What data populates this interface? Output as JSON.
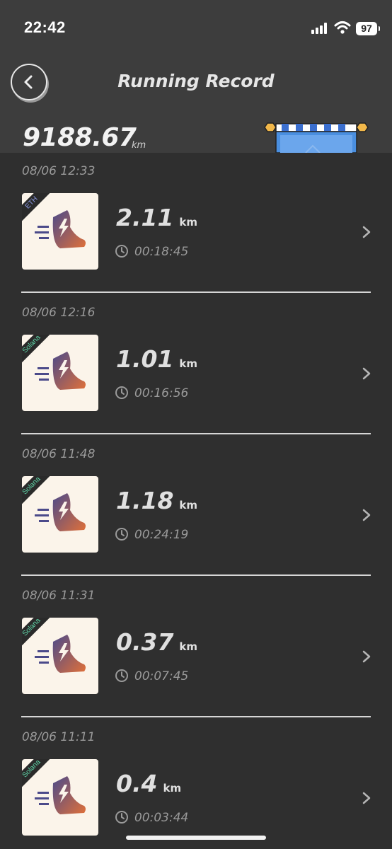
{
  "status_bar": {
    "time": "22:42",
    "battery": "97"
  },
  "header": {
    "title": "Running Record"
  },
  "summary": {
    "total_distance": "9188.67",
    "unit": "km"
  },
  "records": [
    {
      "date": "08/06 12:33",
      "chain": "ETH",
      "distance": "2.11",
      "unit": "km",
      "duration": "00:18:45"
    },
    {
      "date": "08/06 12:16",
      "chain": "Solana",
      "distance": "1.01",
      "unit": "km",
      "duration": "00:16:56"
    },
    {
      "date": "08/06 11:48",
      "chain": "Solana",
      "distance": "1.18",
      "unit": "km",
      "duration": "00:24:19"
    },
    {
      "date": "08/06 11:31",
      "chain": "Solana",
      "distance": "0.37",
      "unit": "km",
      "duration": "00:07:45"
    },
    {
      "date": "08/06 11:11",
      "chain": "Solana",
      "distance": "0.4",
      "unit": "km",
      "duration": "00:03:44"
    }
  ],
  "icons": {
    "back": "back-arrow-icon",
    "clock": "clock-icon",
    "chevron": "chevron-right-icon",
    "shoe": "running-shoe-icon",
    "finish": "finish-gate-icon"
  },
  "colors": {
    "header_bg": "#3d3d3d",
    "list_bg": "#2f2f2f",
    "eth_badge": "#8e9be8",
    "solana_badge": "#5fd6a8",
    "shoe_gradient_start": "#4b4a8a",
    "shoe_gradient_end": "#e0703a"
  }
}
